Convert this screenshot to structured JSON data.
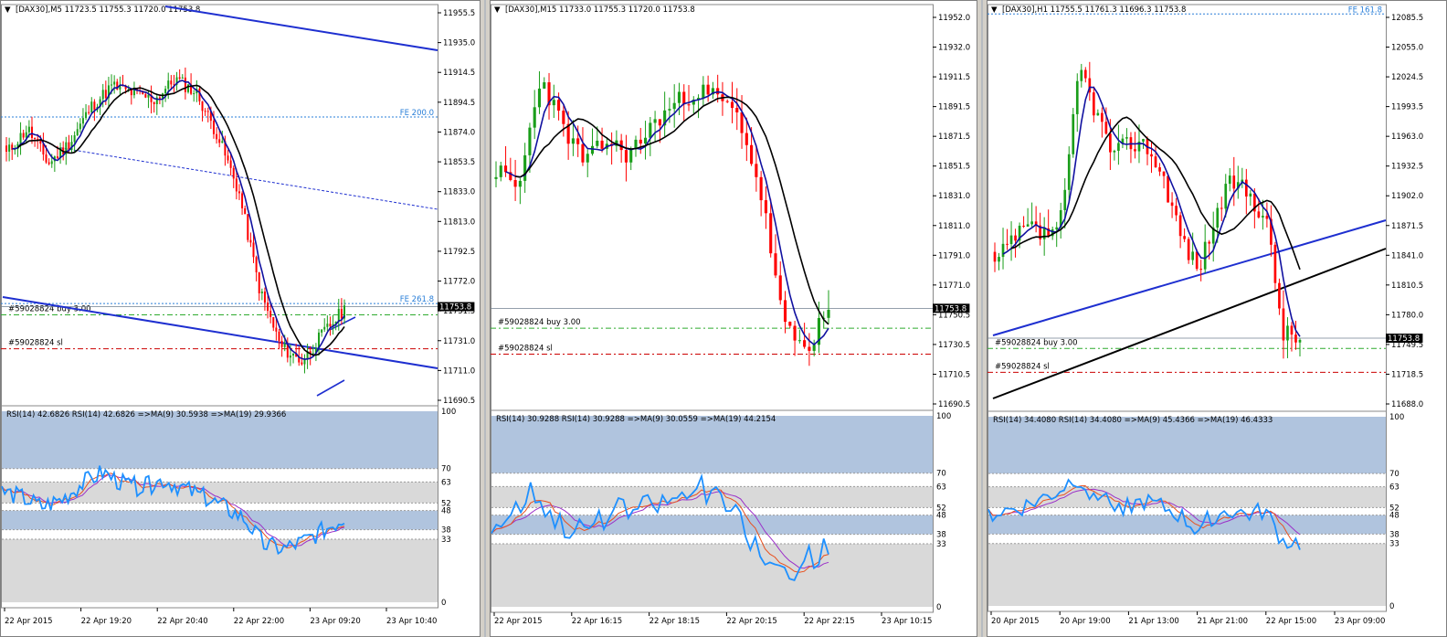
{
  "colors": {
    "bull": "#1a9e1a",
    "bear": "#ff0000",
    "ma_fast": "#1010a0",
    "ma_slow": "#000000",
    "trendline": "#1e2fd0",
    "fe_level": "#2a7fd8",
    "buy_line": "#2eaa2e",
    "sl_line": "#cc0000",
    "rsi_line": "#1e90ff",
    "rsi_ma9": "#e8501e",
    "rsi_ma19": "#9b30c8",
    "rsi_band": "#b0c4de",
    "rsi_gray": "#d9d9d9",
    "price_tag_bg": "#000000"
  },
  "windows": [
    {
      "id": "m5",
      "title": "[DAX30],M5",
      "ohlc": "11723.5 11755.3 11720.0 11753.8",
      "price_axis": [
        "11955.5",
        "11935.0",
        "11914.5",
        "11894.5",
        "11874.0",
        "11853.5",
        "11833.0",
        "11813.0",
        "11792.5",
        "11772.0",
        "11751.5",
        "11731.0",
        "11711.0",
        "11690.5"
      ],
      "current_price": "11753.8",
      "fe_labels": [
        "FE 200.0",
        "FE 261.8"
      ],
      "order_labels": [
        "#59028824 buy 3.00",
        "#59028824 sl"
      ],
      "rsi_header": "RSI(14) 42.6826  RSI(14) 42.6826  =>MA(9) 30.5938  =>MA(19) 29.9366",
      "rsi_axis": [
        "100",
        "70",
        "63",
        "52",
        "48",
        "38",
        "33",
        "0"
      ],
      "time_axis": [
        "22 Apr 2015",
        "22 Apr 19:20",
        "22 Apr 20:40",
        "22 Apr 22:00",
        "23 Apr 09:20",
        "23 Apr 10:40"
      ]
    },
    {
      "id": "m15",
      "title": "[DAX30],M15",
      "ohlc": "11733.0 11755.3 11720.0 11753.8",
      "price_axis": [
        "11952.0",
        "11932.0",
        "11911.5",
        "11891.5",
        "11871.5",
        "11851.5",
        "11831.0",
        "11811.0",
        "11791.0",
        "11771.0",
        "11750.5",
        "11730.5",
        "11710.5",
        "11690.5"
      ],
      "current_price": "11753.8",
      "fe_labels": [],
      "order_labels": [
        "#59028824 buy 3.00",
        "#59028824 sl"
      ],
      "rsi_header": "RSI(14) 30.9288  RSI(14) 30.9288  =>MA(9) 30.0559  =>MA(19) 44.2154",
      "rsi_axis": [
        "100",
        "70",
        "63",
        "52",
        "48",
        "38",
        "33",
        "0"
      ],
      "time_axis": [
        "22 Apr 2015",
        "22 Apr 16:15",
        "22 Apr 18:15",
        "22 Apr 20:15",
        "22 Apr 22:15",
        "23 Apr 10:15"
      ]
    },
    {
      "id": "h1",
      "title": "[DAX30],H1",
      "ohlc": "11755.5 11761.3 11696.3 11753.8",
      "price_axis": [
        "12085.5",
        "12055.0",
        "12024.5",
        "11993.5",
        "11963.0",
        "11932.5",
        "11902.0",
        "11871.5",
        "11841.0",
        "11810.5",
        "11780.0",
        "11749.5",
        "11718.5",
        "11688.0"
      ],
      "current_price": "11753.8",
      "fe_labels": [
        "FE 161.8"
      ],
      "order_labels": [
        "#59028824 buy 3.00",
        "#59028824 sl"
      ],
      "rsi_header": "RSI(14) 34.4080  RSI(14) 34.4080  =>MA(9) 45.4366  =>MA(19) 46.4333",
      "rsi_axis": [
        "100",
        "70",
        "63",
        "52",
        "48",
        "38",
        "33",
        "0"
      ],
      "time_axis": [
        "20 Apr 2015",
        "20 Apr 19:00",
        "21 Apr 13:00",
        "21 Apr 21:00",
        "22 Apr 15:00",
        "23 Apr 09:00"
      ]
    }
  ],
  "chart_data": [
    {
      "type": "candlestick",
      "title": "[DAX30],M5",
      "ylim": [
        11683,
        11965
      ],
      "current_price": 11753.8,
      "levels": {
        "FE 200.0": 11888,
        "FE 261.8": 11756,
        "buy": 11748,
        "sl": 11724
      },
      "rsi": {
        "ylim": [
          0,
          100
        ],
        "bands": [
          [
            70,
            100
          ],
          [
            38,
            48
          ]
        ],
        "gray": [
          [
            52,
            63
          ],
          [
            0,
            33
          ]
        ]
      }
    },
    {
      "type": "candlestick",
      "title": "[DAX30],M15",
      "ylim": [
        11683,
        11962
      ],
      "current_price": 11753.8,
      "levels": {
        "buy": 11740,
        "sl": 11722
      },
      "rsi": {
        "ylim": [
          0,
          100
        ],
        "bands": [
          [
            70,
            100
          ],
          [
            38,
            48
          ]
        ],
        "gray": [
          [
            52,
            63
          ],
          [
            0,
            33
          ]
        ]
      }
    },
    {
      "type": "candlestick",
      "title": "[DAX30],H1",
      "ylim": [
        11680,
        12100
      ],
      "current_price": 11753.8,
      "levels": {
        "FE 161.8": 12094,
        "buy": 11743,
        "sl": 11718
      },
      "rsi": {
        "ylim": [
          0,
          100
        ],
        "bands": [
          [
            70,
            100
          ],
          [
            38,
            48
          ]
        ],
        "gray": [
          [
            52,
            63
          ],
          [
            0,
            33
          ]
        ]
      }
    }
  ]
}
